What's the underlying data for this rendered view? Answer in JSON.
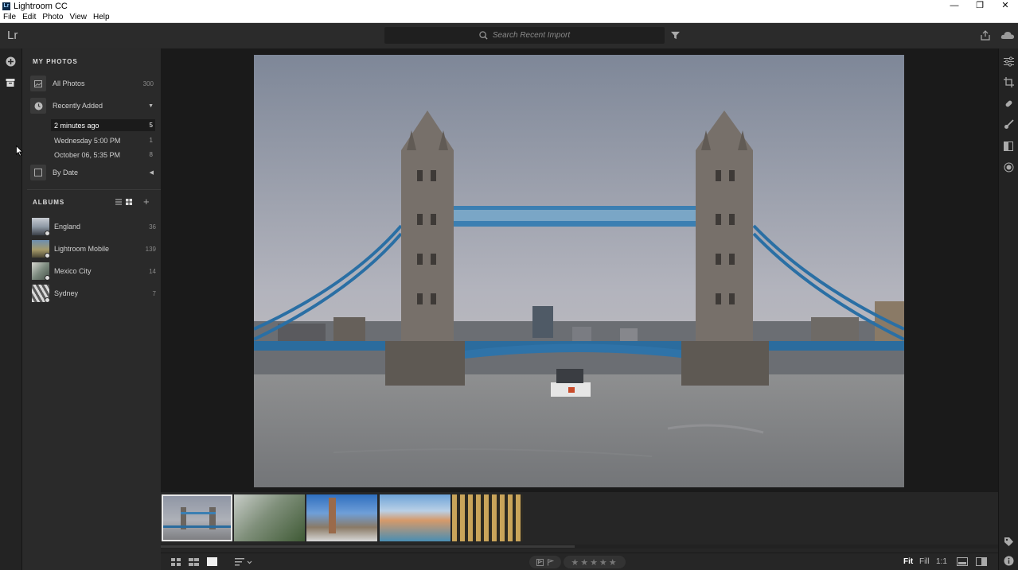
{
  "window": {
    "title": "Lightroom CC",
    "app_icon": "Lr",
    "controls": [
      "minimize-icon",
      "restore-icon",
      "close-icon"
    ]
  },
  "menu": [
    "File",
    "Edit",
    "Photo",
    "View",
    "Help"
  ],
  "topbar": {
    "logo": "Lr",
    "search_placeholder": "Search Recent Import"
  },
  "sidebar": {
    "my_photos_heading": "MY PHOTOS",
    "all_photos": {
      "label": "All Photos",
      "count": "300"
    },
    "recently_added": {
      "label": "Recently Added"
    },
    "recent_items": [
      {
        "label": "2 minutes ago",
        "count": "5"
      },
      {
        "label": "Wednesday  5:00 PM",
        "count": "1"
      },
      {
        "label": "October 06, 5:35 PM",
        "count": "8"
      }
    ],
    "by_date": {
      "label": "By Date"
    },
    "albums_heading": "ALBUMS",
    "albums": [
      {
        "label": "England",
        "count": "36"
      },
      {
        "label": "Lightroom Mobile",
        "count": "139"
      },
      {
        "label": "Mexico City",
        "count": "14"
      },
      {
        "label": "Sydney",
        "count": "7"
      }
    ]
  },
  "bottombar": {
    "zoom_fit": "Fit",
    "zoom_fill": "Fill",
    "zoom_1to1": "1:1",
    "stars": "★★★★★"
  },
  "colors": {
    "accent_blue": "#2a7ab8",
    "panel": "#2a2a2a",
    "background": "#1a1a1a"
  }
}
